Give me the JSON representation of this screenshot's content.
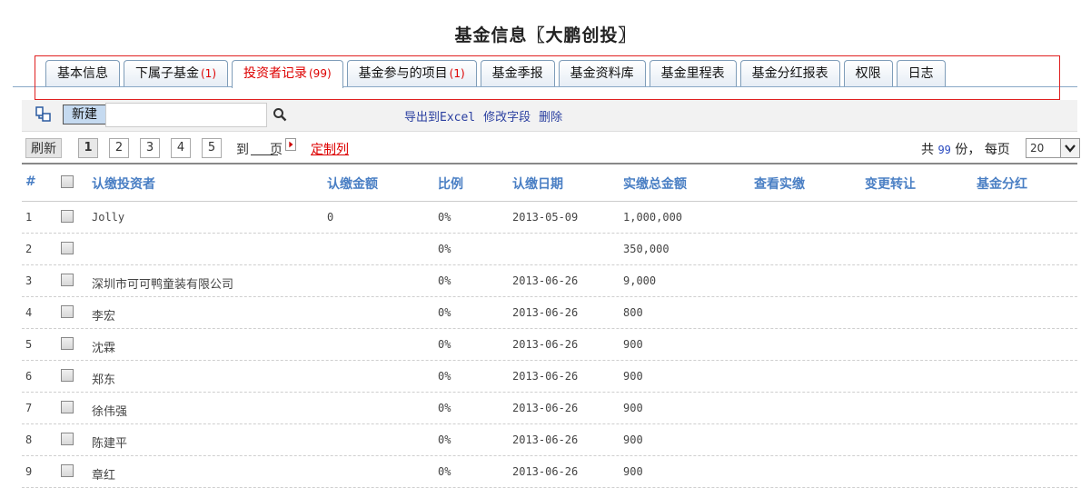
{
  "page_title": "基金信息〖大鹏创投〗",
  "tabs": [
    {
      "label": "基本信息",
      "count": ""
    },
    {
      "label": "下属子基金",
      "count": "(1)"
    },
    {
      "label": "投资者记录",
      "count": "(99)"
    },
    {
      "label": "基金参与的项目",
      "count": "(1)"
    },
    {
      "label": "基金季报",
      "count": ""
    },
    {
      "label": "基金资料库",
      "count": ""
    },
    {
      "label": "基金里程表",
      "count": ""
    },
    {
      "label": "基金分红报表",
      "count": ""
    },
    {
      "label": "权限",
      "count": ""
    },
    {
      "label": "日志",
      "count": ""
    }
  ],
  "active_tab": 2,
  "toolbar": {
    "new_label": "新建",
    "search_value": "",
    "export_label": "导出到Excel",
    "edit_fields_label": "修改字段",
    "delete_label": "删除"
  },
  "pager": {
    "refresh_label": "刷新",
    "pages": [
      "1",
      "2",
      "3",
      "4",
      "5"
    ],
    "current_page": "1",
    "goto_prefix": "到",
    "goto_suffix": "页",
    "custom_columns_label": "定制列",
    "total_prefix": "共",
    "total_count": "99",
    "total_unit": "份，",
    "per_page_label": "每页",
    "per_page_value": "20"
  },
  "columns": {
    "index": "#",
    "investor": "认缴投资者",
    "amount": "认缴金额",
    "ratio": "比例",
    "date": "认缴日期",
    "paid_total": "实缴总金额",
    "view_paid": "查看实缴",
    "transfer": "变更转让",
    "dividend": "基金分红"
  },
  "rows": [
    {
      "index": "1",
      "investor": "Jolly",
      "amount": "0",
      "ratio": "0%",
      "date": "2013-05-09",
      "paid_total": "1,000,000"
    },
    {
      "index": "2",
      "investor": "",
      "amount": "",
      "ratio": "0%",
      "date": "",
      "paid_total": "350,000"
    },
    {
      "index": "3",
      "investor": "深圳市可可鸭童装有限公司",
      "amount": "",
      "ratio": "0%",
      "date": "2013-06-26",
      "paid_total": "9,000"
    },
    {
      "index": "4",
      "investor": "李宏",
      "amount": "",
      "ratio": "0%",
      "date": "2013-06-26",
      "paid_total": "800"
    },
    {
      "index": "5",
      "investor": "沈霖",
      "amount": "",
      "ratio": "0%",
      "date": "2013-06-26",
      "paid_total": "900"
    },
    {
      "index": "6",
      "investor": "郑东",
      "amount": "",
      "ratio": "0%",
      "date": "2013-06-26",
      "paid_total": "900"
    },
    {
      "index": "7",
      "investor": "徐伟强",
      "amount": "",
      "ratio": "0%",
      "date": "2013-06-26",
      "paid_total": "900"
    },
    {
      "index": "8",
      "investor": "陈建平",
      "amount": "",
      "ratio": "0%",
      "date": "2013-06-26",
      "paid_total": "900"
    },
    {
      "index": "9",
      "investor": "章红",
      "amount": "",
      "ratio": "0%",
      "date": "2013-06-26",
      "paid_total": "900"
    }
  ]
}
